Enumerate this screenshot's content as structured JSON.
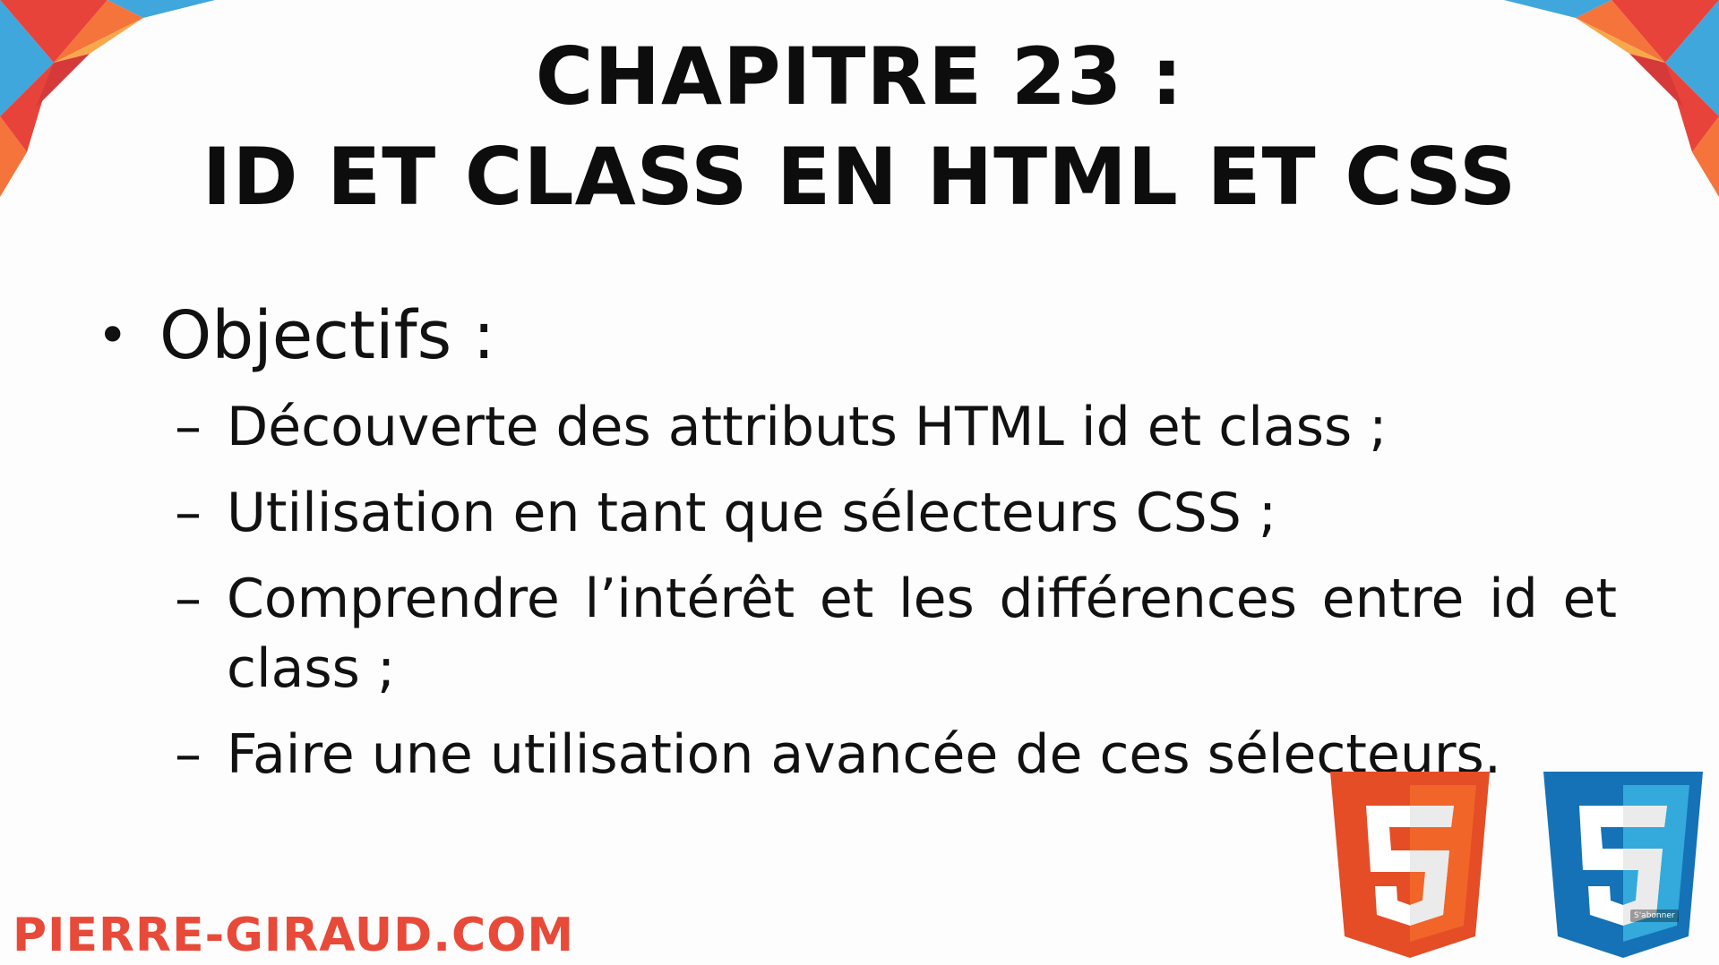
{
  "slide": {
    "title_line1": "CHAPITRE 23 :",
    "title_line2": "ID ET CLASS EN HTML ET CSS",
    "bullet": "Objectifs :",
    "bullet_symbol": "•",
    "dash_symbol": "–",
    "items": [
      "Découverte des attributs HTML id et class ;",
      "Utilisation en tant que sélecteurs CSS ;",
      "Comprendre l’intérêt et les différences entre id et class ;",
      "Faire une utilisation avancée de ces sélecteurs."
    ],
    "site": "PIERRE-GIRAUD.COM",
    "subscribe_label": "S'abonner"
  },
  "colors": {
    "accent_red": "#e84a3a",
    "html_orange": "#e44d26",
    "html_light": "#f16529",
    "css_blue": "#1572b6",
    "css_light": "#33a9dc",
    "corner_blue": "#3fa7dc"
  },
  "icons": {
    "html5_logo": "html5-logo-icon",
    "css3_logo": "css3-logo-icon"
  }
}
